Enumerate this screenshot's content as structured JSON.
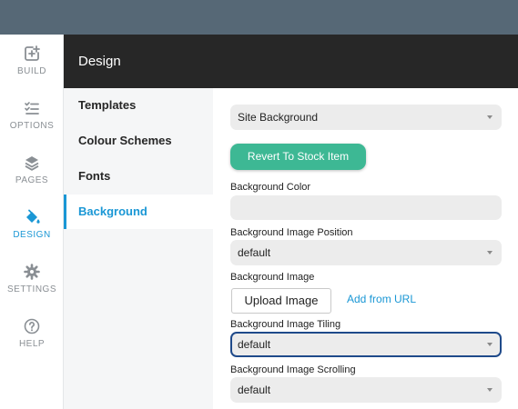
{
  "colors": {
    "accent": "#1a97d5",
    "topbar": "#566876",
    "header": "#272727",
    "revert": "#3db894"
  },
  "nav": {
    "items": [
      {
        "label": "BUILD",
        "icon": "plus-square-icon"
      },
      {
        "label": "OPTIONS",
        "icon": "checklist-icon"
      },
      {
        "label": "PAGES",
        "icon": "layers-icon"
      },
      {
        "label": "DESIGN",
        "icon": "paint-bucket-icon",
        "active": true
      },
      {
        "label": "SETTINGS",
        "icon": "gear-icon"
      },
      {
        "label": "HELP",
        "icon": "question-circle-icon"
      }
    ]
  },
  "panel": {
    "title": "Design"
  },
  "sub_nav": {
    "items": [
      {
        "label": "Templates"
      },
      {
        "label": "Colour Schemes"
      },
      {
        "label": "Fonts"
      },
      {
        "label": "Background",
        "active": true
      }
    ]
  },
  "form": {
    "target_select": "Site Background",
    "revert_label": "Revert To Stock Item",
    "bg_color_label": "Background Color",
    "bg_color_value": "",
    "bg_position_label": "Background Image Position",
    "bg_position_value": "default",
    "bg_image_label": "Background Image",
    "upload_label": "Upload Image",
    "add_url_label": "Add from URL",
    "bg_tiling_label": "Background Image Tiling",
    "bg_tiling_value": "default",
    "bg_scrolling_label": "Background Image Scrolling",
    "bg_scrolling_value": "default"
  }
}
